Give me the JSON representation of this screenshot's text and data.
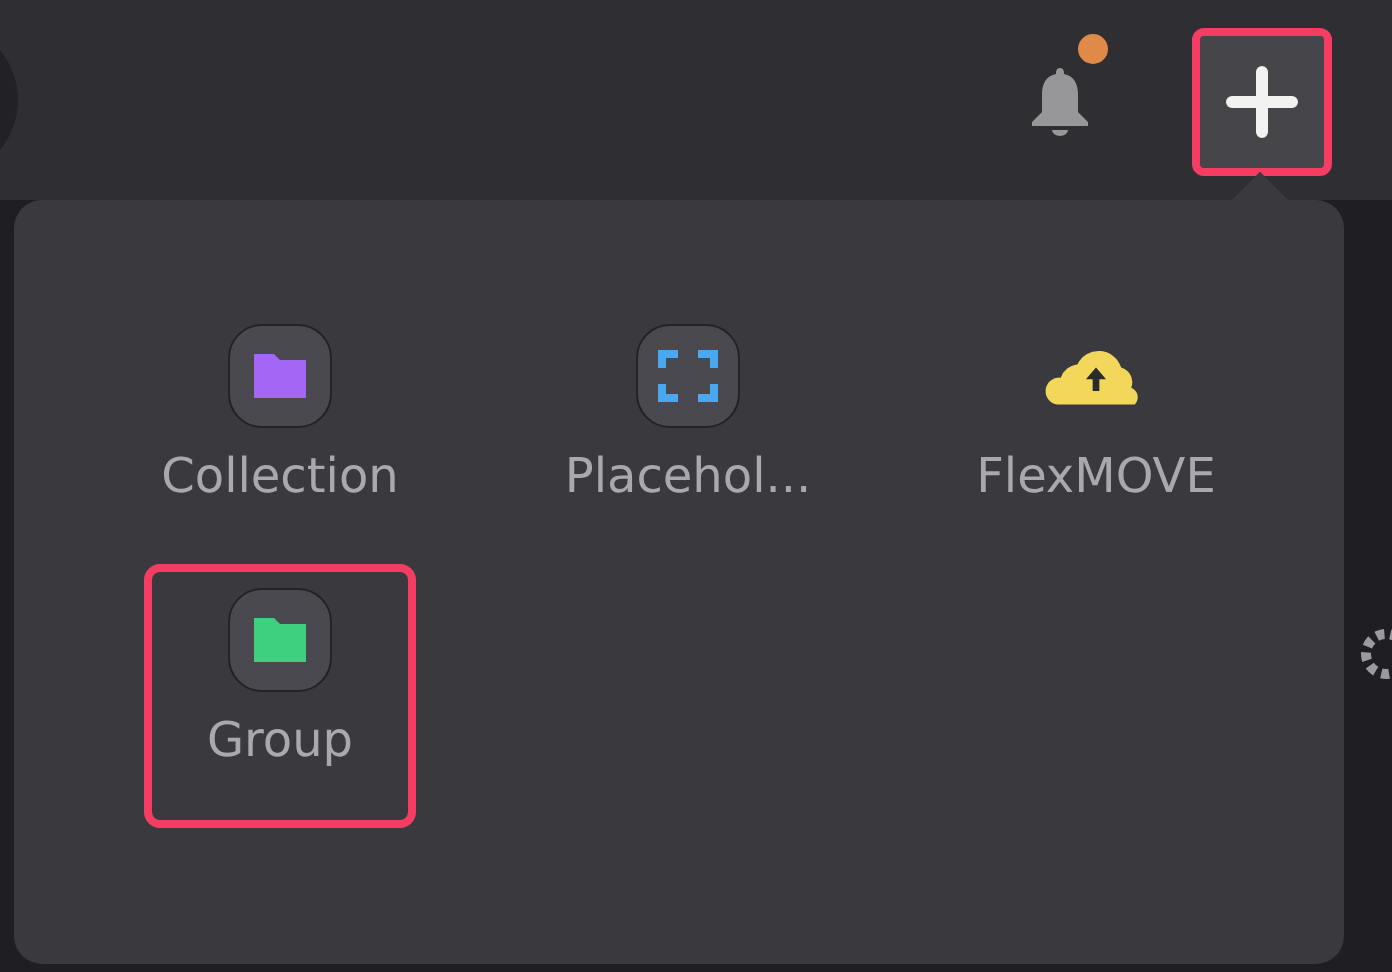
{
  "toolbar": {
    "notification": {
      "unread": true
    },
    "add_button": {
      "highlighted": true
    }
  },
  "menu": {
    "items": [
      {
        "label": "Collection",
        "kind": "folder",
        "color": "#a466f5",
        "highlighted": false
      },
      {
        "label": "Placehol...",
        "kind": "frame",
        "color": "#4aa8f0",
        "highlighted": false
      },
      {
        "label": "FlexMOVE",
        "kind": "cloud",
        "color": "#f2d75a",
        "highlighted": false
      },
      {
        "label": "Group",
        "kind": "folder",
        "color": "#3fd07f",
        "highlighted": true
      }
    ]
  }
}
